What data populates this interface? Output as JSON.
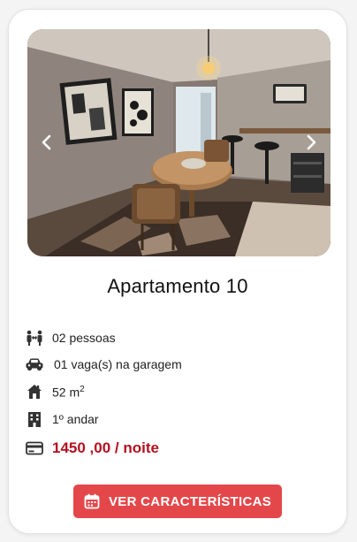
{
  "listing": {
    "title": "Apartamento 10",
    "photo_alt": "",
    "features": {
      "guests": "02 pessoas",
      "parking": "01 vaga(s) na garagem",
      "area_value": "52 m",
      "area_unit_sup": "2",
      "floor": "1º andar",
      "price": "1450 ,00 / noite"
    },
    "button_label": "VER CARACTERÍSTICAS"
  },
  "colors": {
    "accent": "#e4474a",
    "price": "#b3101f"
  },
  "icons": {
    "prev": "chevron-left-icon",
    "next": "chevron-right-icon",
    "guests": "people-icon",
    "parking": "car-icon",
    "area": "house-icon",
    "floor": "building-icon",
    "price": "credit-card-icon",
    "button": "calendar-icon"
  }
}
